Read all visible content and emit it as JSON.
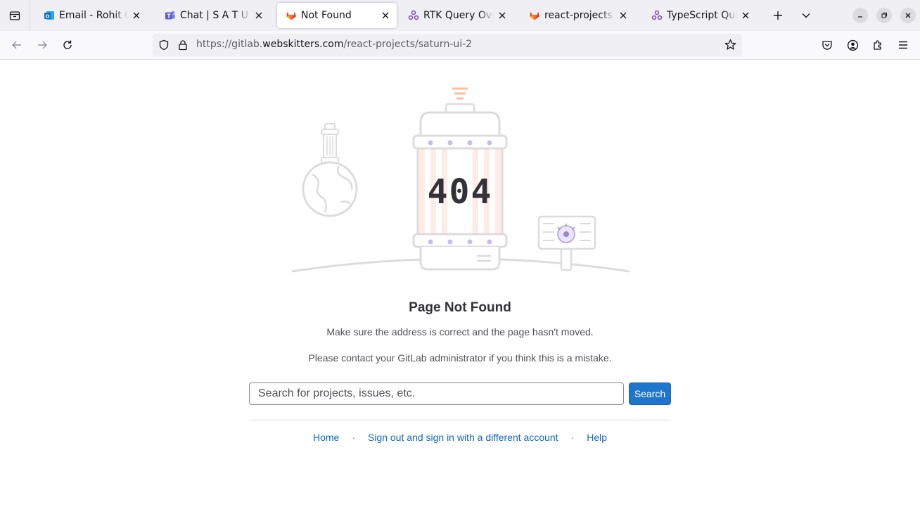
{
  "browser": {
    "tabs": [
      {
        "title": "Email - Rohit Goyal - Outlook",
        "icon": "outlook-icon",
        "color": "#0f6cbd"
      },
      {
        "title": "Chat | S A T U R N | Microsoft Teams",
        "icon": "teams-icon",
        "color": "#5b5fc7"
      },
      {
        "title": "Not Found",
        "icon": "gitlab-icon",
        "color": "#e24329",
        "active": true
      },
      {
        "title": "RTK Query Overview",
        "icon": "redux-icon",
        "color": "#764abc"
      },
      {
        "title": "react-projects · GitLab",
        "icon": "gitlab-icon",
        "color": "#e24329"
      },
      {
        "title": "TypeScript Quick",
        "icon": "redux-icon",
        "color": "#764abc"
      }
    ],
    "url": {
      "prefix": "https://gitlab.",
      "host": "webskitters.com",
      "path": "/react-projects/saturn-ui-2"
    }
  },
  "error": {
    "code": "404",
    "title": "Page Not Found",
    "message": "Make sure the address is correct and the page hasn't moved.",
    "contact": "Please contact your GitLab administrator if you think this is a mistake."
  },
  "search": {
    "placeholder": "Search for projects, issues, etc.",
    "button_label": "Search"
  },
  "footer": {
    "links": [
      "Home",
      "Sign out and sign in with a different account",
      "Help"
    ]
  },
  "colors": {
    "link": "#1068bf",
    "button": "#1f75cb",
    "accent_orange": "#fc6d26",
    "accent_purple": "#7759c2"
  }
}
